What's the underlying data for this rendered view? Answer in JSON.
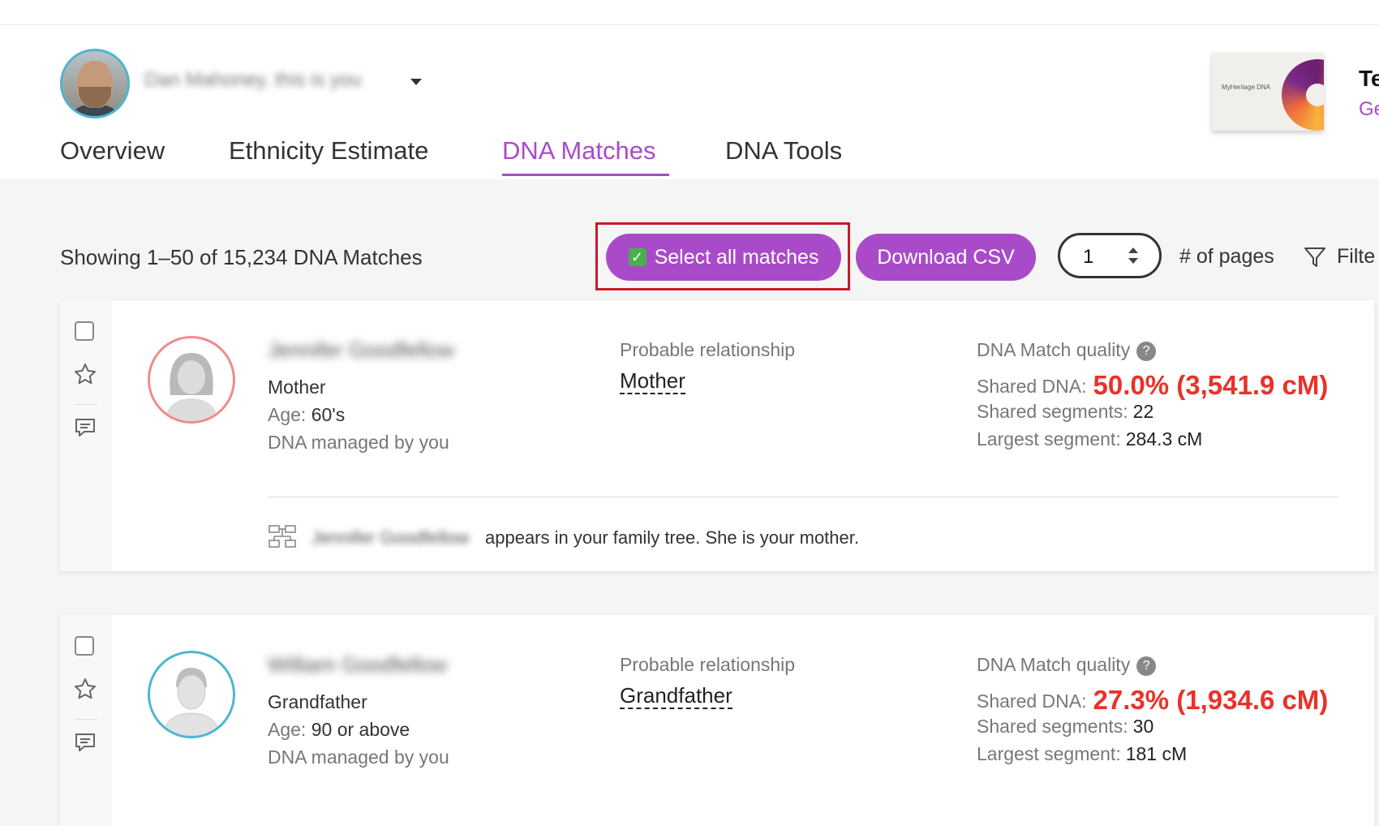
{
  "header": {
    "user_name": "Dan Mahoney, this is you"
  },
  "tabs": [
    {
      "label": "Overview"
    },
    {
      "label": "Ethnicity Estimate"
    },
    {
      "label": "DNA Matches"
    },
    {
      "label": "DNA Tools"
    }
  ],
  "active_tab": "DNA Matches",
  "promo": {
    "kit_logo": "MyHeritage DNA",
    "title": "Te",
    "link": "Ge"
  },
  "toolbar": {
    "showing": "Showing 1–50 of 15,234 DNA Matches",
    "select_all_icon": "✓",
    "select_all": "Select all matches",
    "download_csv": "Download CSV",
    "page_value": "1",
    "pages_label": "# of pages",
    "filter": "Filte"
  },
  "matches": [
    {
      "name": "Jennifer Goodfellow",
      "relationship": "Mother",
      "age_label": "Age:",
      "age": "60's",
      "managed": "DNA managed by you",
      "probable_label": "Probable relationship",
      "probable": "Mother",
      "quality_label": "DNA Match quality",
      "shared_label": "Shared DNA:",
      "shared_value": "50.0% (3,541.9 cM)",
      "segments_label": "Shared segments:",
      "segments": "22",
      "largest_label": "Largest segment:",
      "largest": "284.3 cM",
      "tree_name": "Jennifer Goodfellow",
      "tree_text": "appears in your family tree. She is your mother."
    },
    {
      "name": "William Goodfellow",
      "relationship": "Grandfather",
      "age_label": "Age:",
      "age": "90 or above",
      "managed": "DNA managed by you",
      "probable_label": "Probable relationship",
      "probable": "Grandfather",
      "quality_label": "DNA Match quality",
      "shared_label": "Shared DNA:",
      "shared_value": "27.3% (1,934.6 cM)",
      "segments_label": "Shared segments:",
      "segments": "30",
      "largest_label": "Largest segment:",
      "largest": "181 cM"
    }
  ],
  "colors": {
    "accent": "#a94bc9",
    "highlight": "#e8322a",
    "annotation_box": "#c61c28"
  }
}
